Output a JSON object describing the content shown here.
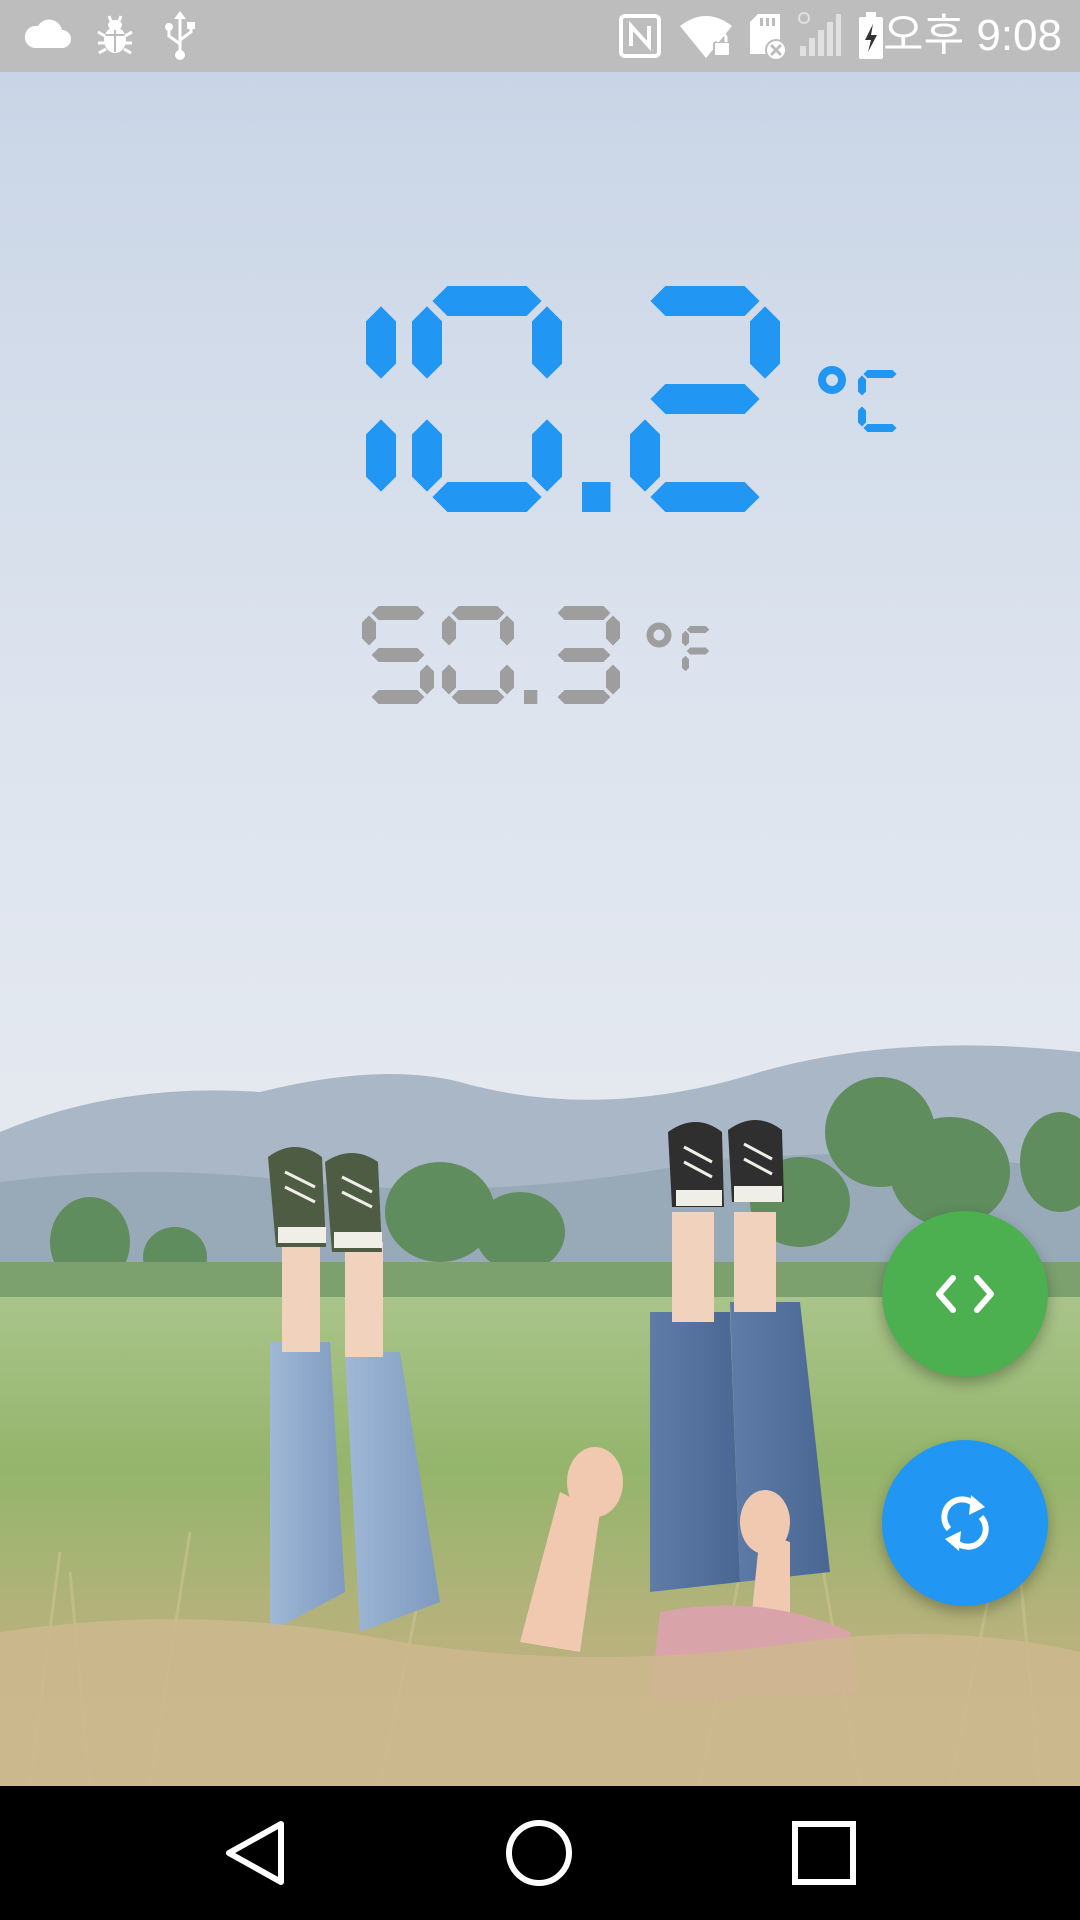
{
  "status_bar": {
    "time": "오후 9:08",
    "left_icons": [
      "cloud-icon",
      "bug-icon",
      "usb-icon"
    ],
    "right_icons": [
      "nfc-icon",
      "wifi-lock-icon",
      "sd-card-error-icon",
      "cellular-signal-icon",
      "battery-charging-icon"
    ]
  },
  "temperature": {
    "celsius_value": "10.2",
    "celsius_unit": "°C",
    "fahrenheit_value": "50.3",
    "fahrenheit_unit": "°F"
  },
  "fabs": {
    "swap_icon": "code-swap-icon",
    "refresh_icon": "refresh-icon"
  },
  "nav_bar": {
    "buttons": [
      "back-icon",
      "home-icon",
      "recents-icon"
    ]
  },
  "colors": {
    "celsius_blue": "#2196f3",
    "fahrenheit_gray": "#9e9e9e",
    "swap_fab_green": "#4caf50",
    "refresh_fab_blue": "#2196f3",
    "status_bar_bg": "#bdbdbd",
    "nav_bar_bg": "#000000"
  }
}
